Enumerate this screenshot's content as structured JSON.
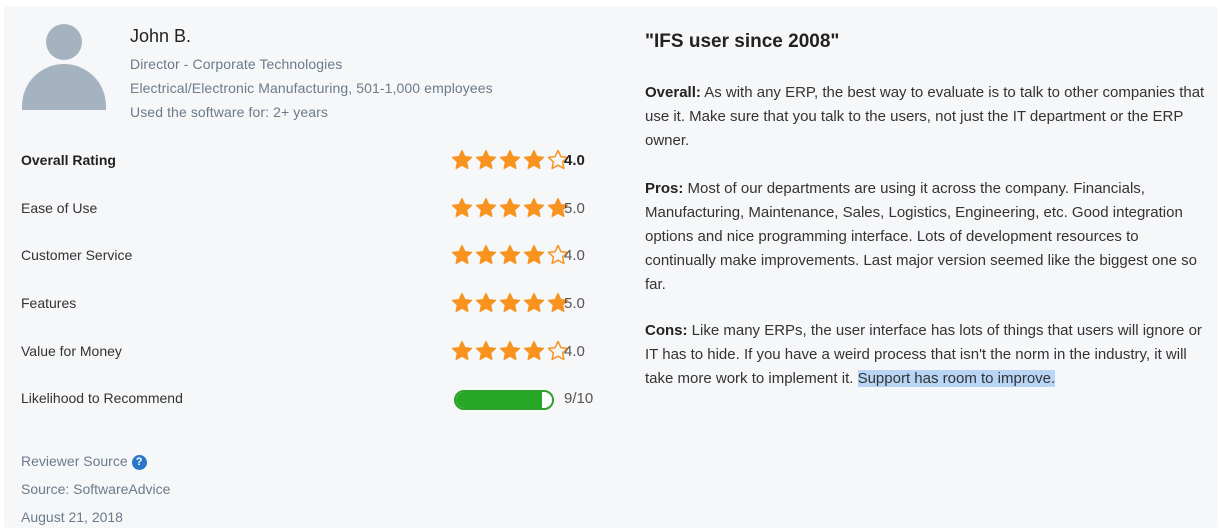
{
  "reviewer": {
    "name": "John B.",
    "title": "Director - Corporate Technologies",
    "company": "Electrical/Electronic Manufacturing, 501-1,000 employees",
    "usage": "Used the software for: 2+ years"
  },
  "ratings": [
    {
      "label": "Overall Rating",
      "stars": 4,
      "value": "4.0"
    },
    {
      "label": "Ease of Use",
      "stars": 5,
      "value": "5.0"
    },
    {
      "label": "Customer Service",
      "stars": 4,
      "value": "4.0"
    },
    {
      "label": "Features",
      "stars": 5,
      "value": "5.0"
    },
    {
      "label": "Value for Money",
      "stars": 4,
      "value": "4.0"
    }
  ],
  "recommend": {
    "label": "Likelihood to Recommend",
    "score": 9,
    "max": 10,
    "value_text": "9/10"
  },
  "footer": {
    "reviewer_source_label": "Reviewer Source",
    "help_icon": "question-circle-icon",
    "source": "Source: SoftwareAdvice",
    "date": "August 21, 2018"
  },
  "review": {
    "title": "\"IFS user since 2008\"",
    "overall_label": "Overall:",
    "overall_text": " As with any ERP, the best way to evaluate is to talk to other companies that use it. Make sure that you talk to the users, not just the IT department or the ERP owner.",
    "pros_label": "Pros:",
    "pros_text": " Most of our departments are using it across the company. Financials, Manufacturing, Maintenance, Sales, Logistics, Engineering, etc. Good integration options and nice programming interface. Lots of development resources to continually make improvements. Last major version seemed like the biggest one so far.",
    "cons_label": "Cons:",
    "cons_text": " Like many ERPs, the user interface has lots of things that users will ignore or IT has to hide. If you have a weird process that isn't the norm in the industry, it will take more work to implement it. ",
    "cons_highlight": "Support has room to improve."
  },
  "colors": {
    "star": "#f7931e",
    "bar": "#26a826",
    "highlight": "#b9d5f5",
    "avatar": "#a5b3c1"
  }
}
